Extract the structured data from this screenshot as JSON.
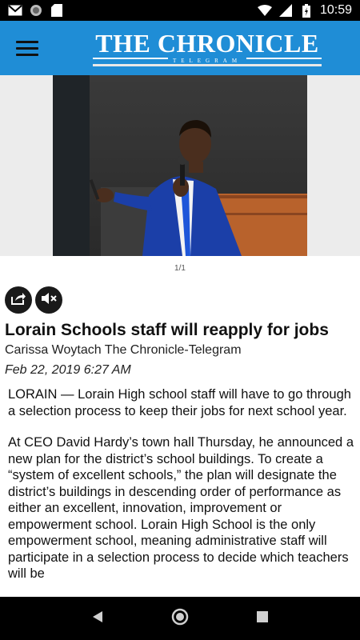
{
  "status_bar": {
    "time": "10:59",
    "left_icons": [
      "gmail-icon",
      "circle-app-icon",
      "sd-card-icon"
    ],
    "right_icons": [
      "wifi-icon",
      "cell-signal-icon",
      "battery-charging-icon"
    ]
  },
  "header": {
    "logo_title": "THE CHRONICLE",
    "logo_subtitle": "TELEGRAM",
    "brand_color": "#1f8dd6"
  },
  "gallery": {
    "counter": "1/1"
  },
  "article": {
    "headline": "Lorain Schools staff will reapply for jobs",
    "byline": "Carissa Woytach The Chronicle-Telegram",
    "date": "Feb 22, 2019 6:27 AM",
    "paragraphs": [
      "LORAIN — Lorain High school staff will have to go through a selection process to keep their jobs for next school year.",
      "At CEO David Hardy’s town hall Thursday, he announced a new plan for the district’s school buildings. To create a “system of excellent schools,” the plan will designate the district’s buildings in descending order of performance as either an excellent, innovation, improvement or empowerment school. Lorain High School is the only empowerment school, meaning administrative staff will participate in a selection process to decide which teachers will be"
    ]
  }
}
